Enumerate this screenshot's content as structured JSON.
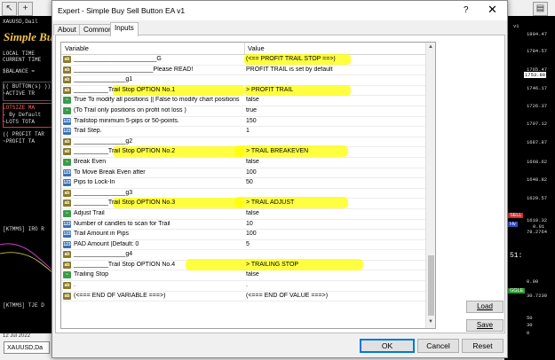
{
  "background": {
    "left_panel": {
      "symbol": "XAUUSD,Dail",
      "brand": "Simple Bu",
      "lines": [
        "LOCAL TIME",
        "CURRENT TIME",
        "$BALANCE =",
        "(( BUTTON(s) ))",
        "~ACTIVE TR",
        "LOTSIZE MA",
        "- By Default",
        "~LOTS TOTA",
        "(( PROFIT TAR",
        "~PROFIT TA",
        "[KTMMS] IRO R",
        "[KTMMS] TJE D"
      ],
      "date": "12 Jul 2022",
      "chart_tab": "XAUUSD,Da"
    },
    "price_scale": {
      "header": "v1",
      "prices": [
        "1804.47",
        "1784.57",
        "1765.47",
        "1753.80",
        "1746.17",
        "1726.37",
        "1707.12",
        "1687.87",
        "1668.62",
        "1648.82",
        "1629.57",
        "1610.32",
        "78.2764",
        "0.00",
        "30.7239",
        "50",
        "30",
        "0"
      ],
      "badges": [
        "SELL",
        "Hv",
        "0.01",
        "51:",
        "GGLE"
      ]
    }
  },
  "dialog": {
    "title": "Expert - Simple Buy Sell Button EA v1",
    "help": "?",
    "close": "✕",
    "tabs": [
      "About",
      "Common",
      "Inputs"
    ],
    "grid": {
      "col_variable": "Variable",
      "col_value": "Value",
      "rows": [
        {
          "type": "ab",
          "name": "________________________G",
          "value": "(<== PROFIT TRAIL STOP ==>)"
        },
        {
          "type": "ab",
          "name": "_______________________Please READ!",
          "value": "PROFIT TRAIL is set by default"
        },
        {
          "type": "ab",
          "name": "_______________g1",
          "value": ""
        },
        {
          "type": "ab",
          "name": "__________Trail Stop OPTION No.1",
          "value": "> PROFIT TRAIL"
        },
        {
          "type": "b",
          "name": "True To modify all positions || False to modify chart positions",
          "value": "false"
        },
        {
          "type": "b",
          "name": "(To Trail only positions on profit not loss )",
          "value": "true"
        },
        {
          "type": "i",
          "name": "Trailstop minimum 5-pips or 50-points.",
          "value": "150"
        },
        {
          "type": "i",
          "name": "Trail Step.",
          "value": "1"
        },
        {
          "type": "ab",
          "name": "_______________g2",
          "value": ""
        },
        {
          "type": "ab",
          "name": "__________Trail Stop OPTION No.2",
          "value": "> TRAIL BREAKEVEN"
        },
        {
          "type": "b",
          "name": "Break Even",
          "value": "false"
        },
        {
          "type": "i",
          "name": "To Move Break Even after",
          "value": "100"
        },
        {
          "type": "i",
          "name": "Pips to Lock-In",
          "value": "50"
        },
        {
          "type": "ab",
          "name": "_______________g3",
          "value": ""
        },
        {
          "type": "ab",
          "name": "__________Trail Stop OPTION No.3",
          "value": "> TRAIL ADJUST"
        },
        {
          "type": "b",
          "name": "Adjust Trail",
          "value": "false"
        },
        {
          "type": "i",
          "name": "Number of candles to scan for Trail",
          "value": "10"
        },
        {
          "type": "i",
          "name": "Trail Amount in Pips",
          "value": "100"
        },
        {
          "type": "i",
          "name": "PAD Amount |Default: 0",
          "value": "5"
        },
        {
          "type": "ab",
          "name": "_______________g4",
          "value": ""
        },
        {
          "type": "ab",
          "name": "__________Trail Stop OPTION No.4",
          "value": "> TRAILING STOP"
        },
        {
          "type": "b",
          "name": "Trailing Stop",
          "value": "false"
        },
        {
          "type": "ab",
          "name": ".",
          "value": "."
        },
        {
          "type": "ab",
          "name": "(<=== END OF VARIABLE ===>)",
          "value": "(<=== END OF VALUE ===>)"
        }
      ]
    },
    "load_label": "Load",
    "save_label": "Save",
    "ok_label": "OK",
    "cancel_label": "Cancel",
    "reset_label": "Reset",
    "highlight_color": "#ffff00"
  }
}
